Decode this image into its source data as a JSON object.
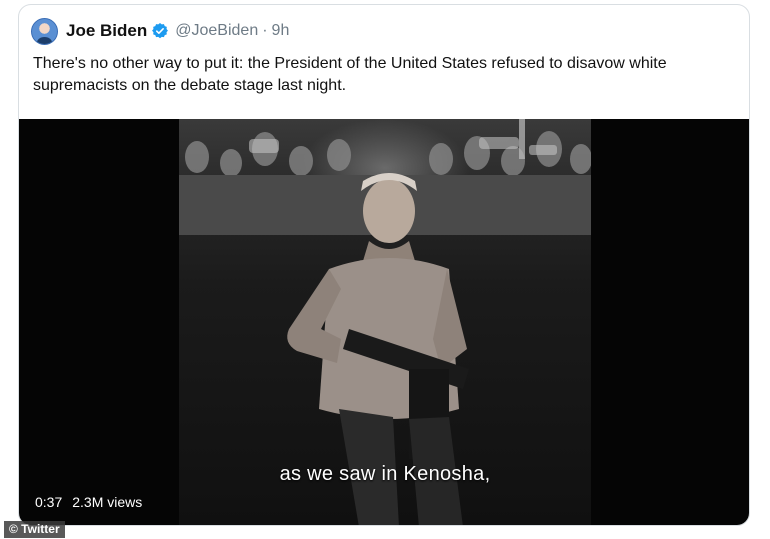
{
  "tweet": {
    "display_name": "Joe Biden",
    "verified_icon": "verified-badge-icon",
    "handle": "@JoeBiden",
    "separator": "·",
    "timestamp": "9h",
    "text": "There's no other way to put it: the President of the United States refused to disavow white supremacists on the debate stage last night."
  },
  "media": {
    "caption": "as we saw in Kenosha,",
    "duration": "0:37",
    "views": "2.3M views"
  },
  "source_credit": "© Twitter",
  "colors": {
    "verified_blue": "#1d9bf0",
    "secondary_text": "#6e7b86",
    "media_background": "#050505"
  }
}
